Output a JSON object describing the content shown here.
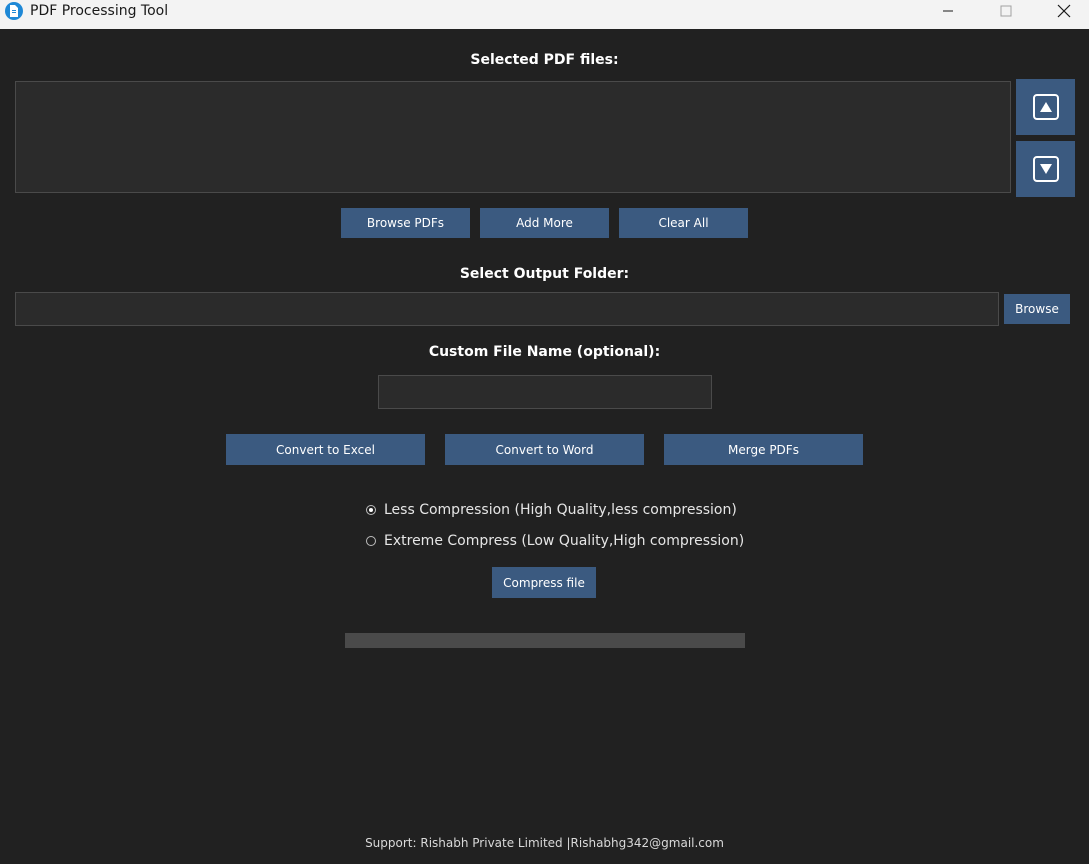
{
  "window": {
    "title": "PDF Processing Tool"
  },
  "files": {
    "label": "Selected PDF files:",
    "items": [],
    "move_up_icon": "arrow-up-box-icon",
    "move_down_icon": "arrow-down-box-icon",
    "browse_label": "Browse PDFs",
    "add_more_label": "Add More",
    "clear_all_label": "Clear All"
  },
  "output": {
    "label": "Select Output Folder:",
    "path_value": "",
    "browse_label": "Browse"
  },
  "custom_name": {
    "label": "Custom File Name (optional):",
    "value": ""
  },
  "actions": {
    "convert_excel_label": "Convert to Excel",
    "convert_word_label": "Convert to Word",
    "merge_label": "Merge PDFs"
  },
  "compression": {
    "options": [
      {
        "label": "Less Compression (High Quality,less compression)",
        "selected": true
      },
      {
        "label": "Extreme Compress (Low Quality,High compression)",
        "selected": false
      }
    ],
    "compress_label": "Compress file"
  },
  "progress": {
    "value": 0
  },
  "footer": {
    "text": "Support: Rishabh Private Limited |Rishabhg342@gmail.com"
  },
  "colors": {
    "background": "#212121",
    "button": "#3b5a80",
    "field": "#2b2b2b"
  }
}
